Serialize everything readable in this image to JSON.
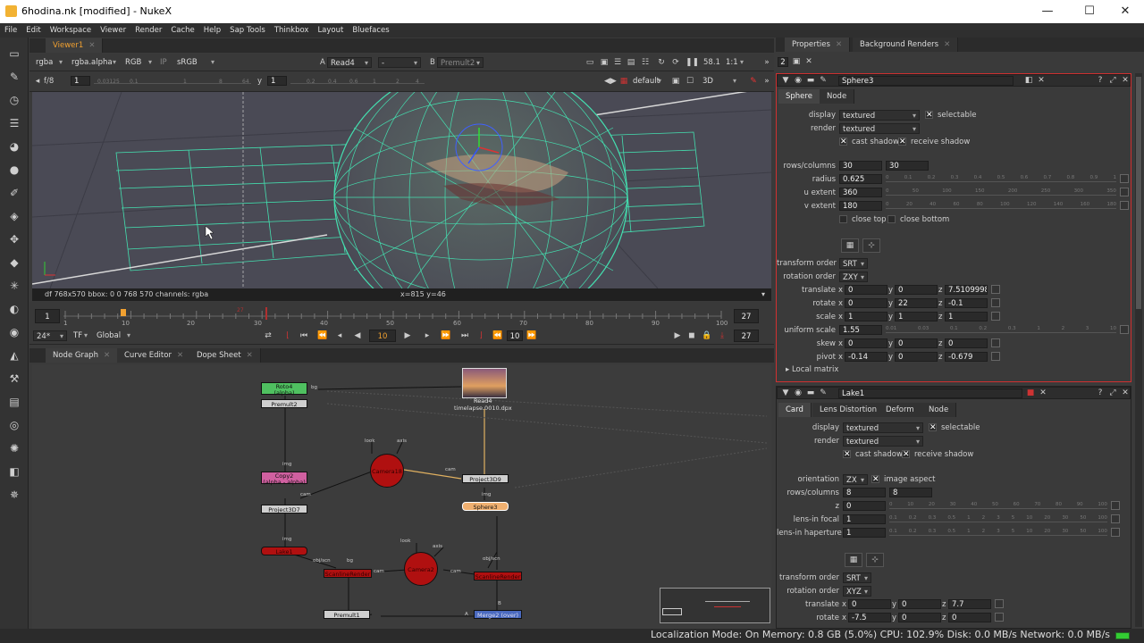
{
  "window": {
    "title": "6hodina.nk [modified] - NukeX",
    "minimize": "—",
    "maximize": "☐",
    "close": "✕"
  },
  "menu": [
    "File",
    "Edit",
    "Workspace",
    "Viewer",
    "Render",
    "Cache",
    "Help",
    "Sap Tools",
    "Thinkbox",
    "Layout",
    "Bluefaces"
  ],
  "viewer": {
    "tab": "Viewer1",
    "channels": "rgba",
    "alpha": "rgba.alpha",
    "colorspace_rgb": "RGB",
    "ip": "IP",
    "lut": "sRGB",
    "a_label": "A",
    "a_input": "Read4",
    "a_op": "-",
    "b_label": "B",
    "b_input": "Premult2",
    "zoom": "58.1",
    "ratio": "1:1",
    "fstop": "f/8",
    "gain": "1",
    "y_label": "y",
    "gamma": "1",
    "gain_ticks": [
      "0.03125",
      "0.1",
      "1",
      "8",
      "64"
    ],
    "gamma_ticks": [
      "0.2",
      "0.4",
      "0.6",
      "1",
      "2",
      "4"
    ],
    "camera": "default",
    "mode": "3D",
    "info_left": "df 768x570  bbox: 0 0 768 570 channels: rgba",
    "info_coords": "x=815 y=46"
  },
  "timeline": {
    "start": "1",
    "end": "27",
    "end_out": "27",
    "current": "10",
    "step": "10",
    "fps": "24*",
    "tf": "TF",
    "scope": "Global",
    "marker": "27",
    "ticks": [
      "1",
      "10",
      "20",
      "30",
      "40",
      "50",
      "60",
      "70",
      "80",
      "90",
      "100"
    ]
  },
  "panels": {
    "node_graph": "Node Graph",
    "curve_editor": "Curve Editor",
    "dope_sheet": "Dope Sheet"
  },
  "nodes": {
    "roto4": "Roto4",
    "roto4_sub": "(alpha)",
    "premult2": "Premult2",
    "read4": "Read4",
    "read4_sub": "timelapse.0010.dpx",
    "copy2": "Copy2",
    "copy2_sub": "(alpha - alpha)",
    "camera18": "Camera18",
    "project3d9": "Project3D9",
    "project3d7": "Project3D7",
    "sphere3": "Sphere3",
    "lake1": "Lake1",
    "camera2": "Camera2",
    "premult1": "Premult1",
    "merge2": "Merge2 (over)",
    "scanline_a": "ScanlineRender",
    "scanline_b": "ScanlineRender",
    "lbl_look": "look",
    "lbl_axis": "axis",
    "lbl_cam": "cam",
    "lbl_img": "img",
    "lbl_bg": "bg",
    "lbl_objscn": "obj/scn",
    "lbl_a": "A",
    "lbl_b": "B"
  },
  "properties": {
    "tab1": "Properties",
    "tab2": "Background Renders",
    "count": "2",
    "sphere": {
      "name": "Sphere3",
      "tabs": [
        "Sphere",
        "Node"
      ],
      "display_label": "display",
      "display": "textured",
      "selectable": "selectable",
      "render_label": "render",
      "render": "textured",
      "cast_shadow": "cast shadow",
      "receive_shadow": "receive shadow",
      "rows_label": "rows/columns",
      "rows": "30",
      "cols": "30",
      "radius_label": "radius",
      "radius": "0.625",
      "uext_label": "u extent",
      "uext": "360",
      "vext_label": "v extent",
      "vext": "180",
      "close_top": "close top",
      "close_bottom": "close bottom",
      "torder_label": "transform order",
      "torder": "SRT",
      "rorder_label": "rotation order",
      "rorder": "ZXY",
      "translate_label": "translate",
      "tx": "0",
      "ty": "0",
      "tz": "7.51099983",
      "rotate_label": "rotate",
      "rx": "0",
      "ry": "22",
      "rz": "-0.1",
      "scale_label": "scale",
      "sx": "1",
      "sy": "1",
      "sz": "1",
      "uscale_label": "uniform scale",
      "uscale": "1.55",
      "skew_label": "skew",
      "kx": "0",
      "ky": "0",
      "kz": "0",
      "pivot_label": "pivot",
      "px": "-0.14",
      "py": "0",
      "pz": "-0.679",
      "local_matrix": "Local matrix",
      "x": "x",
      "y": "y",
      "z": "z",
      "radius_ticks": [
        "0",
        "0.1",
        "0.2",
        "0.3",
        "0.4",
        "0.5",
        "0.6",
        "0.7",
        "0.8",
        "0.9",
        "1"
      ],
      "uext_ticks": [
        "0",
        "50",
        "100",
        "150",
        "200",
        "250",
        "300",
        "350"
      ],
      "vext_ticks": [
        "0",
        "20",
        "40",
        "60",
        "80",
        "100",
        "120",
        "140",
        "160",
        "180"
      ],
      "uscale_ticks": [
        "0.01",
        "0.03",
        "0.1",
        "0.2",
        "0.3",
        "1",
        "2",
        "3",
        "10"
      ]
    },
    "card": {
      "name": "Lake1",
      "tabs": [
        "Card",
        "Lens Distortion",
        "Deform",
        "Node"
      ],
      "display_label": "display",
      "display": "textured",
      "selectable": "selectable",
      "render_label": "render",
      "render": "textured",
      "cast_shadow": "cast shadow",
      "receive_shadow": "receive shadow",
      "orient_label": "orientation",
      "orient": "ZX",
      "image_aspect": "image aspect",
      "rows_label": "rows/columns",
      "rows": "8",
      "cols": "8",
      "z_label": "z",
      "z": "0",
      "focal_label": "lens-in focal",
      "focal": "1",
      "haperture_label": "lens-in haperture",
      "haperture": "1",
      "torder_label": "transform order",
      "torder": "SRT",
      "rorder_label": "rotation order",
      "rorder": "XYZ",
      "translate_label": "translate",
      "tx": "0",
      "ty": "0",
      "tz": "7.7",
      "rotate_label": "rotate",
      "rx": "-7.5",
      "ry": "0",
      "rz": "0",
      "x": "x",
      "y": "y",
      "z_axis": "z",
      "z_ticks": [
        "0",
        "10",
        "20",
        "30",
        "40",
        "50",
        "60",
        "70",
        "80",
        "90",
        "100"
      ],
      "focal_ticks": [
        "0.1",
        "0.2",
        "0.3",
        "0.5",
        "1",
        "2",
        "3",
        "5",
        "10",
        "20",
        "30",
        "50",
        "100"
      ],
      "haperture_ticks": [
        "0.1",
        "0.2",
        "0.3",
        "0.5",
        "1",
        "2",
        "3",
        "5",
        "10",
        "20",
        "30",
        "50",
        "100"
      ]
    }
  },
  "status": {
    "text": "Localization Mode: On Memory: 0.8 GB (5.0%) CPU: 102.9% Disk: 0.0 MB/s Network: 0.0 MB/s"
  },
  "colors": {
    "wire": "#44e0b0",
    "accent": "#f0a030",
    "node_red": "#b01010",
    "node_green": "#4fc060"
  }
}
